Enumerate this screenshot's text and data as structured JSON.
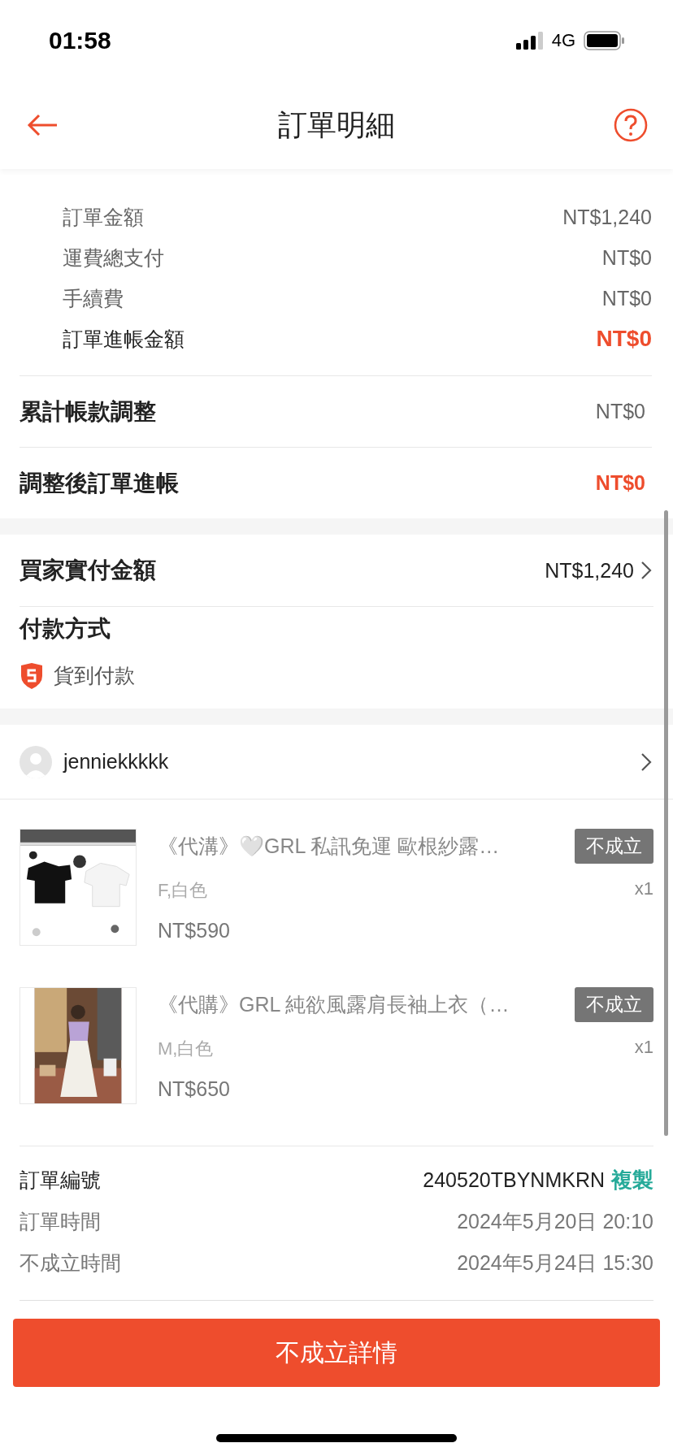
{
  "status_bar": {
    "time": "01:58",
    "network": "4G"
  },
  "header": {
    "title": "訂單明細"
  },
  "payment_info": {
    "rows": [
      {
        "label": "訂單金額",
        "value": "NT$1,240",
        "emphasis": false
      },
      {
        "label": "運費總支付",
        "value": "NT$0",
        "emphasis": false
      },
      {
        "label": "手續費",
        "value": "NT$0",
        "emphasis": false
      },
      {
        "label": "訂單進帳金額",
        "value": "NT$0",
        "emphasis": true
      }
    ]
  },
  "adjustments": [
    {
      "label": "累計帳款調整",
      "value": "NT$0",
      "emphasis": false
    },
    {
      "label": "調整後訂單進帳",
      "value": "NT$0",
      "emphasis": true
    }
  ],
  "buyer_paid": {
    "label": "買家實付金額",
    "value": "NT$1,240"
  },
  "payment_method": {
    "title": "付款方式",
    "method": "貨到付款"
  },
  "seller": {
    "username": "jenniekkkkk"
  },
  "items": [
    {
      "title": "《代溝》🤍GRL 私訊免運 歐根紗露…",
      "status": "不成立",
      "variant": "F,白色",
      "quantity": "x1",
      "price": "NT$590"
    },
    {
      "title": "《代購》GRL 純欲風露肩長袖上衣（…",
      "status": "不成立",
      "variant": "M,白色",
      "quantity": "x1",
      "price": "NT$650"
    }
  ],
  "order_info": {
    "rows": [
      {
        "kind": "id",
        "label": "訂單編號",
        "value": "240520TBYNMKRN",
        "action": "複製"
      },
      {
        "kind": "time",
        "label": "訂單時間",
        "value": "2024年5月20日 20:10"
      },
      {
        "kind": "time",
        "label": "不成立時間",
        "value": "2024年5月24日 15:30"
      }
    ]
  },
  "footer_button": "不成立詳情"
}
